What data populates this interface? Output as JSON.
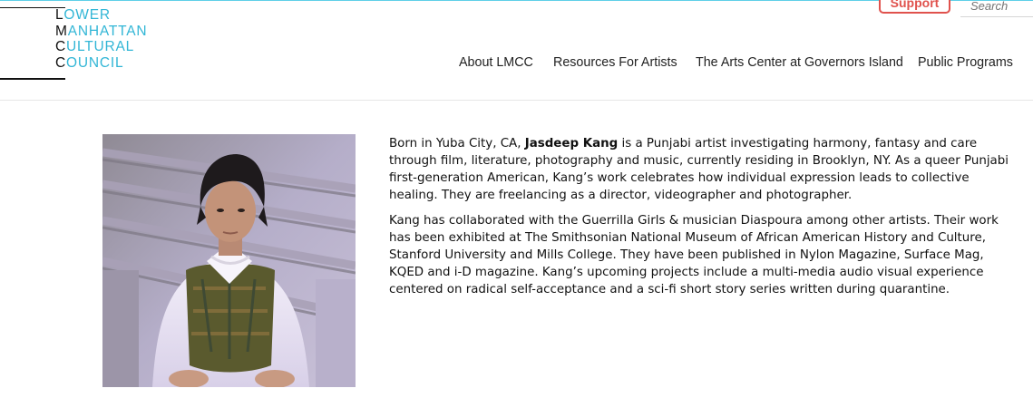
{
  "logo": {
    "lines": [
      {
        "initial": "L",
        "rest": "OWER"
      },
      {
        "initial": "M",
        "rest": "ANHATTAN"
      },
      {
        "initial": "C",
        "rest": "ULTURAL"
      },
      {
        "initial": "C",
        "rest": "OUNCIL"
      }
    ],
    "accent_color": "#32b6d6"
  },
  "header": {
    "support_label": "Support",
    "search_placeholder": "Search",
    "support_color": "#e0524d"
  },
  "nav": {
    "items": [
      "About LMCC",
      "Resources For Artists",
      "The Arts Center at Governors Island",
      "Public Programs"
    ]
  },
  "bio": {
    "p1_before": "Born in Yuba City, CA, ",
    "p1_name": "Jasdeep Kang",
    "p1_after": " is a Punjabi artist investigating harmony, fantasy and care through film, literature, photography and music, currently residing in Brooklyn, NY. As a queer Punjabi first-generation American, Kang’s work celebrates how individual expression leads to collective healing. They are freelancing as a director, videographer and photographer.",
    "p2": "Kang has collaborated with the Guerrilla Girls & musician Diaspoura among other artists. Their work has been exhibited at The Smithsonian National Museum of African American History and Culture, Stanford University and Mills College. They have been published in Nylon Magazine, Surface Mag, KQED and i-D magazine. Kang’s upcoming projects include a multi-media audio visual experience centered on radical self-acceptance and a sci-fi short story series written during quarantine."
  }
}
